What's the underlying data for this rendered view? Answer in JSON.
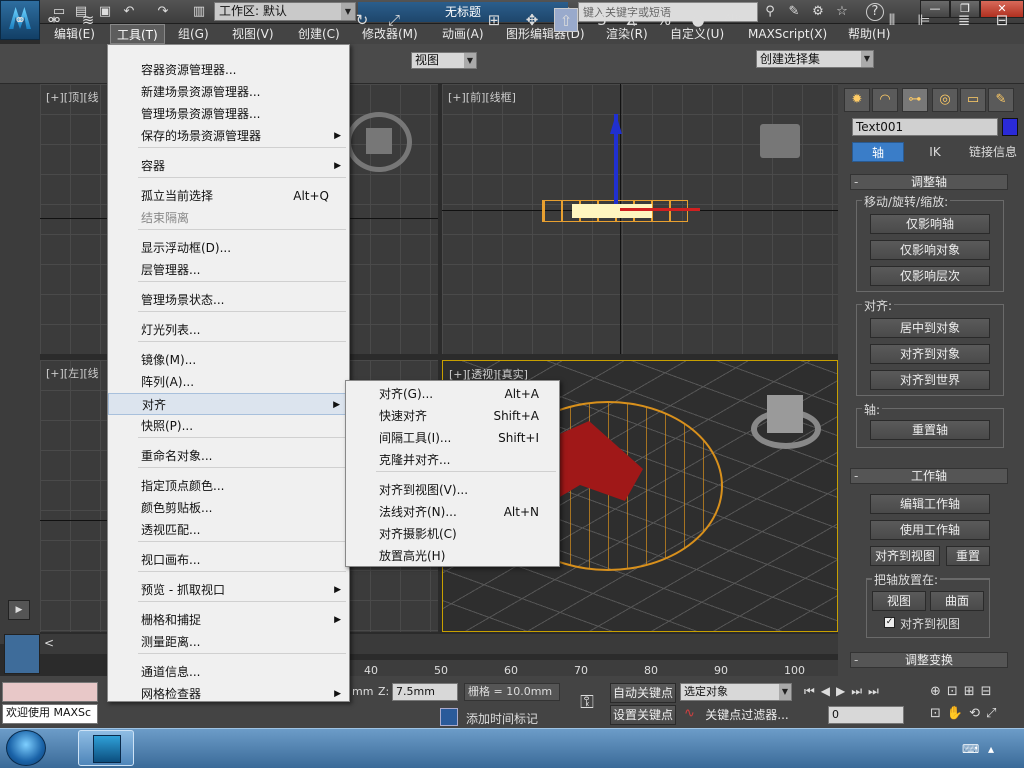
{
  "titlebar": {
    "workspace_label": "工作区: 默认",
    "doc_title": "无标题",
    "search_placeholder": "键入关键字或短语",
    "help_label": "?"
  },
  "menubar": [
    "编辑(E)",
    "工具(T)",
    "组(G)",
    "视图(V)",
    "创建(C)",
    "修改器(M)",
    "动画(A)",
    "图形编辑器(D)",
    "渲染(R)",
    "自定义(U)",
    "MAXScript(X)",
    "帮助(H)"
  ],
  "toolbar": {
    "view_select": "视图",
    "snap_3": "3",
    "snap_pct": "%",
    "selection_set": "创建选择集"
  },
  "viewports": {
    "top": "[+][顶][线",
    "front": "[+][前][线框]",
    "left": "[+][左][线",
    "persp": "[+][透视][真实]"
  },
  "tools_menu": [
    {
      "label": "容器资源管理器...",
      "shortcut": "",
      "arrow": false,
      "disabled": false
    },
    {
      "label": "新建场景资源管理器...",
      "shortcut": "",
      "arrow": false,
      "disabled": false
    },
    {
      "label": "管理场景资源管理器...",
      "shortcut": "",
      "arrow": false,
      "disabled": false
    },
    {
      "label": "保存的场景资源管理器",
      "shortcut": "",
      "arrow": true,
      "disabled": false
    },
    {
      "label": "容器",
      "shortcut": "",
      "arrow": true,
      "disabled": false
    },
    {
      "label": "孤立当前选择",
      "shortcut": "Alt+Q",
      "arrow": false,
      "disabled": false
    },
    {
      "label": "结束隔离",
      "shortcut": "",
      "arrow": false,
      "disabled": true
    },
    {
      "label": "显示浮动框(D)...",
      "shortcut": "",
      "arrow": false,
      "disabled": false
    },
    {
      "label": "层管理器...",
      "shortcut": "",
      "arrow": false,
      "disabled": false
    },
    {
      "label": "管理场景状态...",
      "shortcut": "",
      "arrow": false,
      "disabled": false
    },
    {
      "label": "灯光列表...",
      "shortcut": "",
      "arrow": false,
      "disabled": false
    },
    {
      "label": "镜像(M)...",
      "shortcut": "",
      "arrow": false,
      "disabled": false
    },
    {
      "label": "阵列(A)...",
      "shortcut": "",
      "arrow": false,
      "disabled": false
    },
    {
      "label": "对齐",
      "shortcut": "",
      "arrow": true,
      "disabled": false
    },
    {
      "label": "快照(P)...",
      "shortcut": "",
      "arrow": false,
      "disabled": false
    },
    {
      "label": "重命名对象...",
      "shortcut": "",
      "arrow": false,
      "disabled": false
    },
    {
      "label": "指定顶点颜色...",
      "shortcut": "",
      "arrow": false,
      "disabled": false
    },
    {
      "label": "颜色剪贴板...",
      "shortcut": "",
      "arrow": false,
      "disabled": false
    },
    {
      "label": "透视匹配...",
      "shortcut": "",
      "arrow": false,
      "disabled": false
    },
    {
      "label": "视口画布...",
      "shortcut": "",
      "arrow": false,
      "disabled": false
    },
    {
      "label": "预览 - 抓取视口",
      "shortcut": "",
      "arrow": true,
      "disabled": false
    },
    {
      "label": "栅格和捕捉",
      "shortcut": "",
      "arrow": true,
      "disabled": false
    },
    {
      "label": "测量距离...",
      "shortcut": "",
      "arrow": false,
      "disabled": false
    },
    {
      "label": "通道信息...",
      "shortcut": "",
      "arrow": false,
      "disabled": false
    },
    {
      "label": "网格检查器",
      "shortcut": "",
      "arrow": true,
      "disabled": false
    }
  ],
  "align_submenu": [
    {
      "label": "对齐(G)...",
      "shortcut": "Alt+A"
    },
    {
      "label": "快速对齐",
      "shortcut": "Shift+A"
    },
    {
      "label": "间隔工具(I)...",
      "shortcut": "Shift+I"
    },
    {
      "label": "克隆并对齐...",
      "shortcut": ""
    },
    {
      "label": "对齐到视图(V)...",
      "shortcut": ""
    },
    {
      "label": "法线对齐(N)...",
      "shortcut": "Alt+N"
    },
    {
      "label": "对齐摄影机(C)",
      "shortcut": ""
    },
    {
      "label": "放置高光(H)",
      "shortcut": ""
    }
  ],
  "command_panel": {
    "object_name": "Text001",
    "object_color": "#2a2ad8",
    "subtabs": [
      "轴",
      "IK",
      "链接信息"
    ],
    "adjust_pivot": {
      "title": "调整轴",
      "move_group": "移动/旋转/缩放:",
      "buttons": [
        "仅影响轴",
        "仅影响对象",
        "仅影响层次"
      ],
      "align_group": "对齐:",
      "align_buttons": [
        "居中到对象",
        "对齐到对象",
        "对齐到世界"
      ],
      "pivot_group": "轴:",
      "reset_button": "重置轴"
    },
    "working_pivot": {
      "title": "工作轴",
      "buttons": [
        "编辑工作轴",
        "使用工作轴"
      ],
      "align_view": "对齐到视图",
      "reset": "重置",
      "place_group": "把轴放置在:",
      "place_buttons": [
        "视图",
        "曲面"
      ],
      "checkbox_label": "对齐到视图"
    },
    "adjust_transform_title": "调整变换",
    "sign": "-"
  },
  "timeline": {
    "ticks": [
      "40",
      "50",
      "60",
      "70",
      "80",
      "90",
      "100"
    ],
    "lt": "<"
  },
  "statusbar": {
    "welcome": "欢迎使用 MAXSc",
    "z_label": "Z:",
    "z_value": "7.5mm",
    "mm_partial": "mm",
    "grid": "栅格 = 10.0mm",
    "autokey": "自动关键点",
    "setkey": "设置关键点",
    "selected_object": "选定对象",
    "key_filter": "关键点过滤器...",
    "add_time_tag": "添加时间标记",
    "frame_value": "0"
  }
}
